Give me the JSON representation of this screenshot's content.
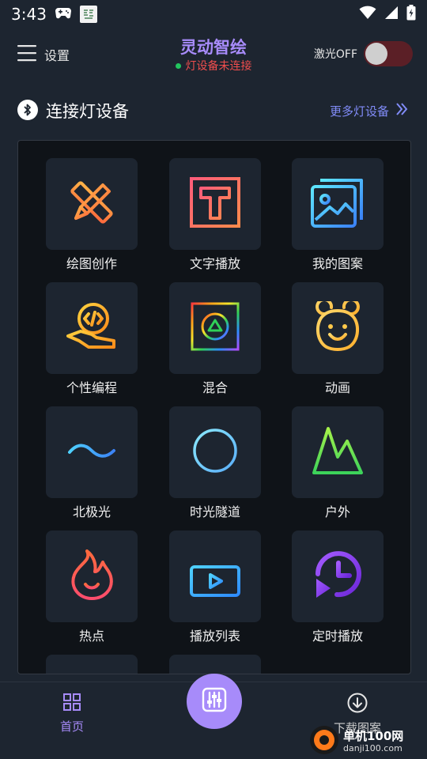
{
  "status_bar": {
    "time": "3:43"
  },
  "header": {
    "menu_label": "设置",
    "app_title": "灵动智绘",
    "connection_status": "灯设备未连接",
    "laser_label": "激光OFF",
    "laser_on": false
  },
  "section": {
    "title": "连接灯设备",
    "more_link": "更多灯设备"
  },
  "features": [
    {
      "label": "绘图创作",
      "icon": "pencil-ruler-icon"
    },
    {
      "label": "文字播放",
      "icon": "text-t-icon"
    },
    {
      "label": "我的图案",
      "icon": "gallery-icon"
    },
    {
      "label": "个性编程",
      "icon": "code-hand-icon"
    },
    {
      "label": "混合",
      "icon": "rainbow-square-icon"
    },
    {
      "label": "动画",
      "icon": "bear-face-icon"
    },
    {
      "label": "北极光",
      "icon": "wave-icon"
    },
    {
      "label": "时光隧道",
      "icon": "circle-icon"
    },
    {
      "label": "户外",
      "icon": "mountain-icon"
    },
    {
      "label": "热点",
      "icon": "flame-icon"
    },
    {
      "label": "播放列表",
      "icon": "playlist-icon"
    },
    {
      "label": "定时播放",
      "icon": "clock-play-icon"
    }
  ],
  "bottom_nav": {
    "home_label": "首页",
    "download_label": "下载图案"
  },
  "watermark": {
    "title": "单机100网",
    "sub": "danji100.com"
  },
  "colors": {
    "background": "#1d2530",
    "accent": "#a78bfa",
    "status_red": "#ef4d4d",
    "link": "#818cf8"
  }
}
